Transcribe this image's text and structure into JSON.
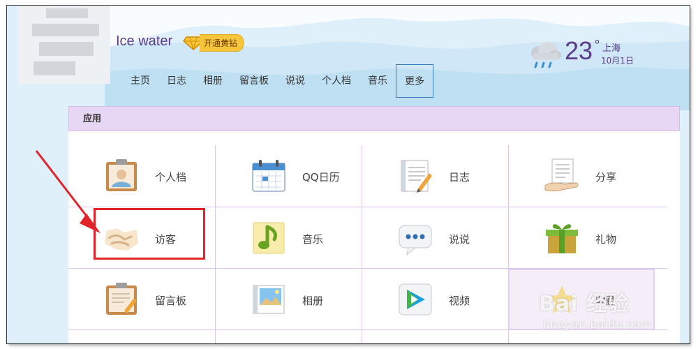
{
  "profile": {
    "name": "Ice water",
    "vip_label": "开通黄钻"
  },
  "nav": {
    "items": [
      {
        "label": "主页"
      },
      {
        "label": "日志"
      },
      {
        "label": "相册"
      },
      {
        "label": "留言板"
      },
      {
        "label": "说说"
      },
      {
        "label": "个人档"
      },
      {
        "label": "音乐"
      },
      {
        "label": "更多",
        "active": true
      }
    ]
  },
  "weather": {
    "icon": "rain-cloud-icon",
    "temperature": "23",
    "degree": "°",
    "city": "上海",
    "date": "10月1日"
  },
  "panel": {
    "title": "应用",
    "rows": [
      [
        {
          "label": "个人档",
          "icon": "profile-card-icon"
        },
        {
          "label": "QQ日历",
          "icon": "calendar-icon"
        },
        {
          "label": "日志",
          "icon": "blog-note-icon"
        },
        {
          "label": "分享",
          "icon": "share-hand-icon"
        }
      ],
      [
        {
          "label": "访客",
          "icon": "handshake-icon"
        },
        {
          "label": "音乐",
          "icon": "music-note-icon"
        },
        {
          "label": "说说",
          "icon": "speech-bubble-icon"
        },
        {
          "label": "礼物",
          "icon": "gift-box-icon"
        }
      ],
      [
        {
          "label": "留言板",
          "icon": "message-board-icon"
        },
        {
          "label": "相册",
          "icon": "photo-album-icon"
        },
        {
          "label": "视频",
          "icon": "video-play-icon"
        },
        {
          "label": "收藏",
          "icon": "star-favorite-icon"
        }
      ]
    ]
  },
  "watermark": {
    "text": "Bai 经验",
    "sub": "jingyan.baidu.com"
  },
  "colors": {
    "accent": "#5b3d8c",
    "panel_header": "#e7d6f4",
    "annotation": "#e0242a",
    "sky": "#dff0fa"
  }
}
